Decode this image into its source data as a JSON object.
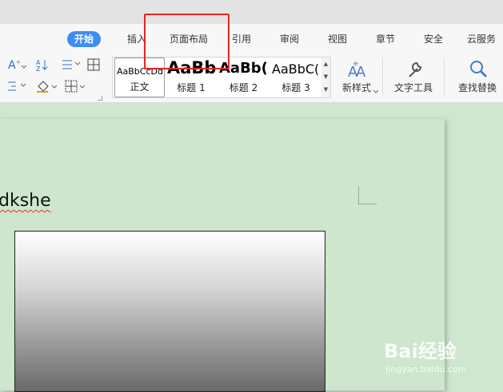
{
  "tabs": [
    {
      "label": "开始",
      "active": true
    },
    {
      "label": "插入"
    },
    {
      "label": "页面布局"
    },
    {
      "label": "引用"
    },
    {
      "label": "审阅"
    },
    {
      "label": "视图"
    },
    {
      "label": "章节"
    },
    {
      "label": "安全"
    },
    {
      "label": "云服务"
    }
  ],
  "ribbon": {
    "styles": [
      {
        "preview": "AaBbCcDd",
        "label": "正文"
      },
      {
        "preview": "AaBb",
        "label": "标题 1"
      },
      {
        "preview": "AaBb(",
        "label": "标题 2"
      },
      {
        "preview": "AaBbC(",
        "label": "标题 3"
      }
    ],
    "new_style": {
      "label": "新样式",
      "icon": "new-style-icon"
    },
    "text_tools": {
      "label": "文字工具",
      "icon": "wrench-icon"
    },
    "find_replace": {
      "label": "查找替换",
      "icon": "magnifier-icon"
    }
  },
  "document": {
    "text": "dkshe"
  },
  "annotation": {
    "color": "#e8251f"
  },
  "watermark": {
    "brand": "Bai经验",
    "url": "jingyan.baidu.com"
  },
  "colors": {
    "accent": "#3f8cf4",
    "page_bg": "#cde6cd"
  }
}
